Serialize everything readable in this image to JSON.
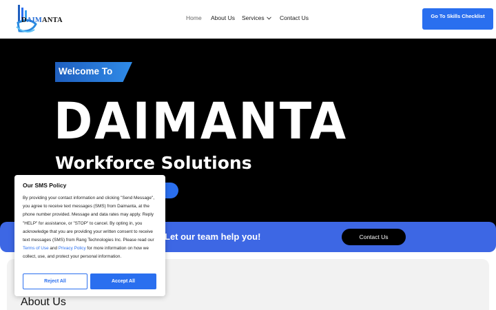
{
  "header": {
    "logo": {
      "text_main": "D",
      "text_accent": "AIM",
      "text_rest": "ANTA",
      "icon": "daimanta-logo-icon"
    },
    "nav": {
      "home": "Home",
      "about": "About Us",
      "services": "Services",
      "contact": "Contact Us"
    },
    "cta_label": "Go To Skills Checklist"
  },
  "hero": {
    "welcome": "Welcome To",
    "brand": "DAIMANTA",
    "subtitle": "Workforce Solutions"
  },
  "band": {
    "text": "Let our team help you!",
    "button": "Contact Us"
  },
  "about": {
    "title": "About Us"
  },
  "sms_policy": {
    "title": "Our SMS Policy",
    "body_part1": "By providing your contact information and clicking \"Send Message\", you agree to receive text messages (SMS) from Daimanta, at the phone number provided. Message and data rates may apply. Reply \"HELP\" for assistance, or \"STOP\" to cancel. By opting in, you acknowledge that you are providing your written consent to receive text messages (SMS) from Rang Technologies Inc. Please read our ",
    "terms_link": "Terms of Use",
    "body_part2": " and ",
    "privacy_link": "Privacy Policy",
    "body_part3": " for more information on how we collect, use, and protect your personal information.",
    "reject": "Reject All",
    "accept": "Accept All"
  },
  "colors": {
    "accent": "#2a6fef",
    "band": "#3d67e4",
    "hero_bg": "#000000"
  }
}
